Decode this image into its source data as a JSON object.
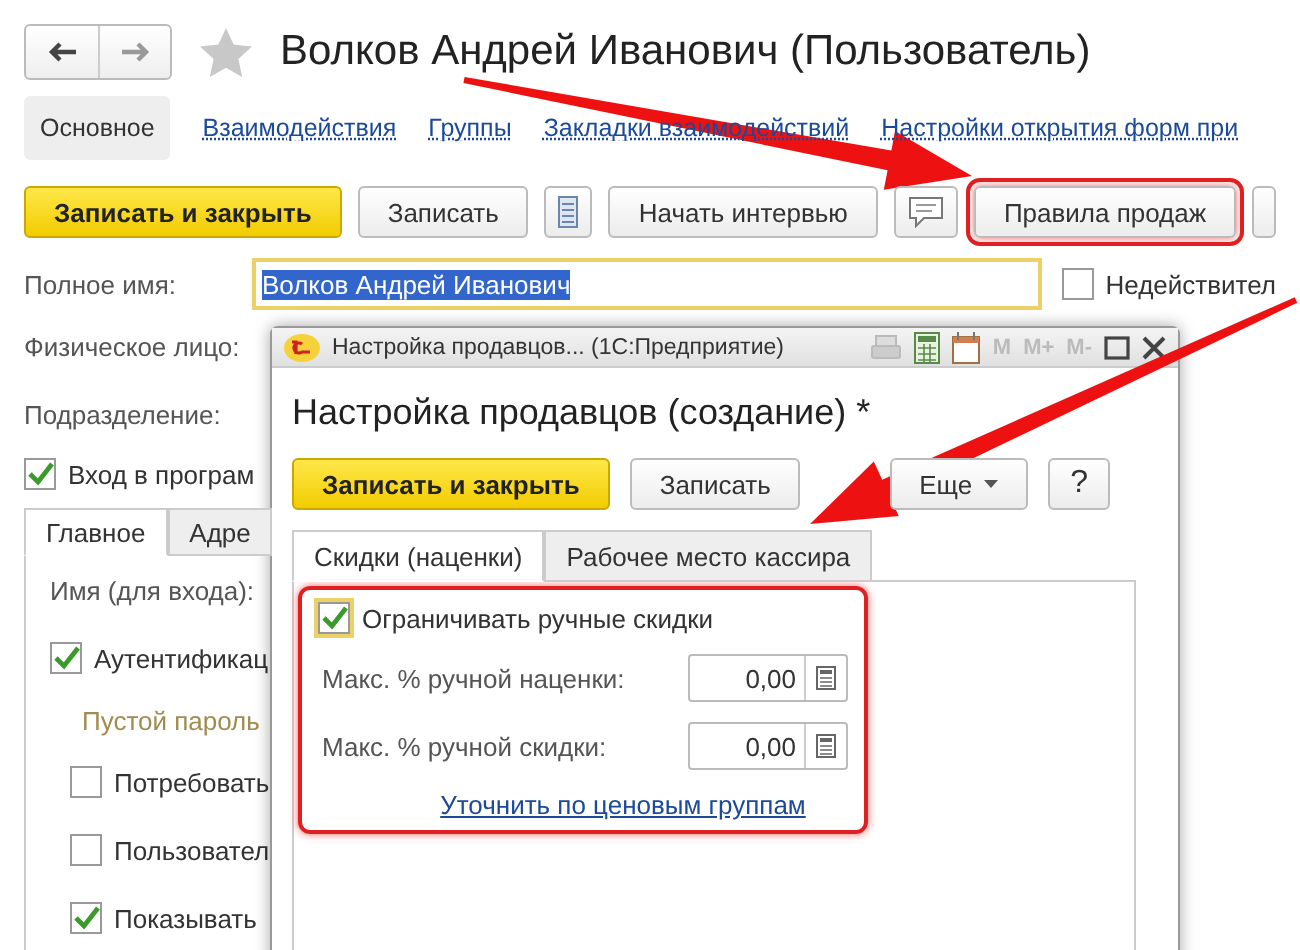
{
  "window": {
    "title": "Волков Андрей Иванович (Пользователь)"
  },
  "nav_tabs": [
    {
      "label": "Основное",
      "selected": true
    },
    {
      "label": "Взаимодействия",
      "selected": false
    },
    {
      "label": "Группы",
      "selected": false
    },
    {
      "label": "Закладки взаимодействий",
      "selected": false
    },
    {
      "label": "Настройки открытия форм при",
      "selected": false
    }
  ],
  "toolbar": [
    {
      "kind": "primary",
      "label": "Записать и закрыть",
      "highlighted": false
    },
    {
      "kind": "button",
      "label": "Записать",
      "highlighted": false
    },
    {
      "kind": "list",
      "highlighted": false
    },
    {
      "kind": "button",
      "label": "Начать интервью",
      "highlighted": false
    },
    {
      "kind": "comment",
      "highlighted": false
    },
    {
      "kind": "button",
      "label": "Правила продаж",
      "highlighted": true
    },
    {
      "kind": "stub",
      "highlighted": false
    }
  ],
  "full_name": {
    "label": "Полное имя:",
    "value": "Волков Андрей Иванович",
    "text_selected": true
  },
  "inactive": {
    "label": "Недействител",
    "checked": false
  },
  "fields": [
    {
      "label": "Физическое лицо:"
    },
    {
      "label": "Подразделение:"
    }
  ],
  "login": {
    "label": "Вход в програм",
    "checked": true
  },
  "tabs": [
    {
      "label": "Главное",
      "selected": true
    },
    {
      "label": "Адре",
      "selected": false
    }
  ],
  "main_tab": [
    {
      "kind": "field",
      "label": "Имя (для входа):"
    },
    {
      "kind": "check",
      "label": "Аутентификац",
      "checked": true,
      "children": [
        {
          "kind": "note",
          "label": "Пустой пароль"
        },
        {
          "kind": "check",
          "label": "Потребовать",
          "checked": false
        },
        {
          "kind": "check",
          "label": "Пользовател",
          "checked": false
        },
        {
          "kind": "check",
          "label": "Показывать",
          "checked": true
        }
      ]
    }
  ],
  "dialog": {
    "title": "Настройка продавцов... (1С:Предприятие)",
    "memory_buttons": [
      "M",
      "M+",
      "M-"
    ],
    "heading": "Настройка продавцов (создание) *",
    "buttons": [
      {
        "kind": "primary",
        "label": "Записать и закрыть"
      },
      {
        "kind": "button",
        "label": "Записать"
      },
      {
        "kind": "menu",
        "label": "Еще"
      },
      {
        "kind": "help",
        "label": "?"
      }
    ],
    "tabs": [
      {
        "label": "Скидки (наценки)",
        "selected": true
      },
      {
        "label": "Рабочее место кассира",
        "selected": false
      }
    ],
    "highlighted": true,
    "limit": {
      "label": "Ограничивать ручные скидки",
      "checked": true
    },
    "fields": [
      {
        "label": "Макс. % ручной наценки:",
        "value": "0,00"
      },
      {
        "label": "Макс. % ручной скидки:",
        "value": "0,00"
      }
    ],
    "link": "Уточнить по ценовым группам"
  }
}
